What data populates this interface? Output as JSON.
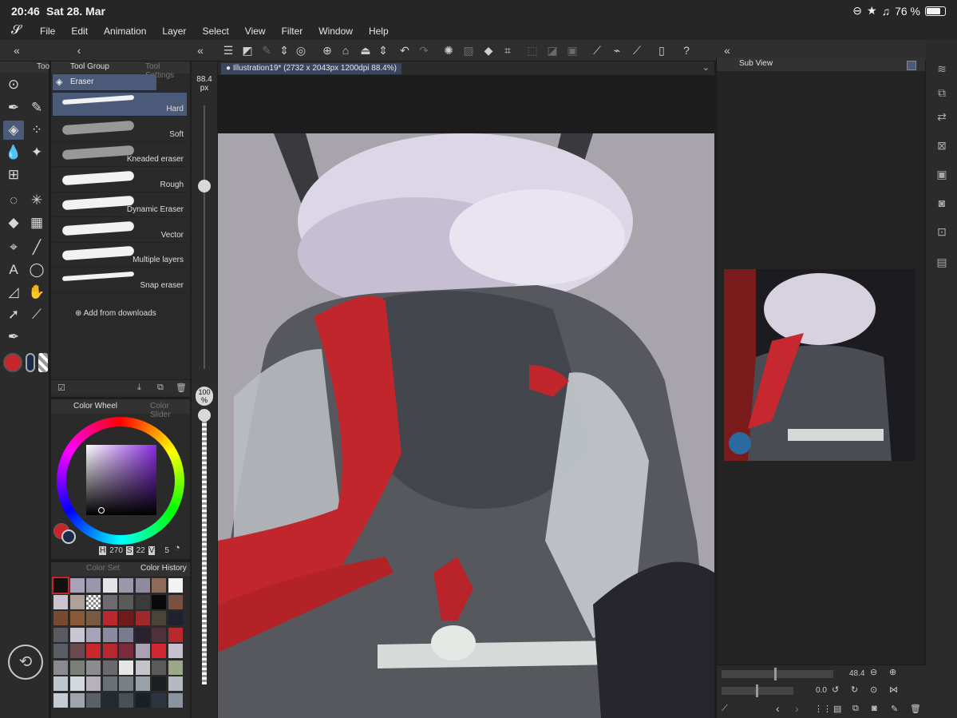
{
  "status": {
    "time": "20:46",
    "date": "Sat 28. Mar",
    "battery": "76 %"
  },
  "menu": [
    "File",
    "Edit",
    "Animation",
    "Layer",
    "Select",
    "View",
    "Filter",
    "Window",
    "Help"
  ],
  "tool_palette": {
    "tab_label": "Too"
  },
  "subtool": {
    "tab_group": "Tool Group",
    "tab_settings": "Tool Settings",
    "current": "Eraser",
    "brushes": [
      {
        "label": "Hard",
        "selected": true
      },
      {
        "label": "Soft",
        "selected": false
      },
      {
        "label": "Kneaded eraser",
        "selected": false
      },
      {
        "label": "Rough",
        "selected": false
      },
      {
        "label": "Dynamic Eraser",
        "selected": false
      },
      {
        "label": "Vector",
        "selected": false
      },
      {
        "label": "Multiple layers",
        "selected": false
      },
      {
        "label": "Snap eraser",
        "selected": false
      }
    ],
    "add_downloads": "Add from downloads"
  },
  "size_slider": {
    "value": "88.4",
    "unit": "px",
    "opacity_value": "100",
    "opacity_unit": "%"
  },
  "color": {
    "tab_wheel": "Color Wheel",
    "tab_slider": "Color Slider",
    "h_label": "H",
    "h": "270",
    "s_label": "S",
    "s": "22",
    "v_label": "V",
    "v": "5",
    "main_color": "#c4262c",
    "sub_color": "#1a2a4a"
  },
  "history": {
    "tab_set": "Color Set",
    "tab_history": "Color History",
    "swatches": [
      "#111111",
      "#a8a3b8",
      "#9a97ac",
      "#e6e2ea",
      "#9c98ac",
      "#8e8aa0",
      "#8f6a58",
      "#f2f2f2",
      "#c9c4ce",
      "#b0a09a",
      "checker",
      "#6e6a72",
      "#5a5a5a",
      "#3b3b3b",
      "#0a0a0a",
      "#7a5040",
      "#7a4a30",
      "#8a5a38",
      "#7a5a40",
      "#b8282c",
      "#701a1c",
      "#a02828",
      "#4a4438",
      "#1e2230",
      "#5a5a62",
      "#c8c6d2",
      "#a6a2b8",
      "#8a8aa0",
      "#7a7a90",
      "#2a2030",
      "#50303a",
      "#b8282c",
      "#5a5c66",
      "#6a4a50",
      "#c8282c",
      "#b82830",
      "#7a2a3a",
      "#a8a2b4",
      "#d02830",
      "#c8c0cc",
      "#8a8a92",
      "#7a8078",
      "#8a8c90",
      "#6a6a6e",
      "#e6e6e6",
      "#c4c4cc",
      "#5a5c5c",
      "#9aa888",
      "#bfc6cc",
      "#d2d8dc",
      "#b8b0bc",
      "#6a7078",
      "#7a8088",
      "#9aa0a8",
      "#1c1e20",
      "#b4b8c2",
      "#c6ccd4",
      "#a0a4ae",
      "#5a6068",
      "#222a30",
      "#4a5058",
      "#1a2028",
      "#2c3440",
      "#8a94a0"
    ]
  },
  "document": {
    "tab": "Illustration19* (2732 x 2043px 1200dpi 88.4%)"
  },
  "subview": {
    "tab": "Sub View",
    "zoom": "48.4",
    "rotation": "0.0"
  }
}
